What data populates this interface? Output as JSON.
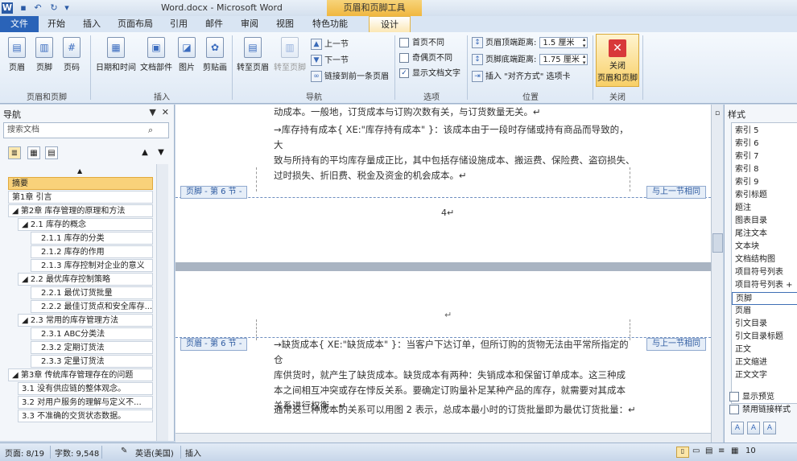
{
  "titlebar": {
    "title": "Word.docx - Microsoft Word",
    "context_group": "页眉和页脚工具"
  },
  "tabs": [
    "文件",
    "开始",
    "插入",
    "页面布局",
    "引用",
    "邮件",
    "审阅",
    "视图",
    "特色功能",
    "设计"
  ],
  "ribbon": {
    "groups": {
      "header_footer": "页眉和页脚",
      "insert": "插入",
      "navigation": "导航",
      "options": "选项",
      "position": "位置",
      "close": "关闭"
    },
    "header_btn": "页眉",
    "footer_btn": "页脚",
    "page_number_btn": "页码",
    "date_time_btn": "日期和时间",
    "doc_parts_btn": "文档部件",
    "picture_btn": "图片",
    "clipart_btn": "剪贴画",
    "goto_header_btn": "转至页眉",
    "goto_footer_btn": "转至页脚",
    "prev_section": "上一节",
    "next_section": "下一节",
    "link_previous": "链接到前一条页眉",
    "opt_diff_first": "首页不同",
    "opt_odd_even": "奇偶页不同",
    "opt_show_text": "显示文档文字",
    "header_top_label": "页眉顶端距离:",
    "header_top_value": "1.5 厘米",
    "footer_bottom_label": "页脚底端距离:",
    "footer_bottom_value": "1.75 厘米",
    "insert_align_tab": "插入 \"对齐方式\" 选项卡",
    "close_btn_line1": "关闭",
    "close_btn_line2": "页眉和页脚"
  },
  "nav": {
    "title": "导航",
    "search_placeholder": "搜索文档",
    "items": [
      {
        "label": "摘要",
        "level": 0,
        "selected": true
      },
      {
        "label": "第1章 引言",
        "level": 0
      },
      {
        "label": "◢ 第2章 库存管理的原理和方法",
        "level": 0
      },
      {
        "label": "◢ 2.1 库存的概念",
        "level": 1
      },
      {
        "label": "2.1.1 库存的分类",
        "level": 2
      },
      {
        "label": "2.1.2 库存的作用",
        "level": 2
      },
      {
        "label": "2.1.3 库存控制对企业的意义",
        "level": 2
      },
      {
        "label": "◢ 2.2 最优库存控制策略",
        "level": 1
      },
      {
        "label": "2.2.1 最优订货批量",
        "level": 2
      },
      {
        "label": "2.2.2 最佳订货点和安全库存...",
        "level": 2
      },
      {
        "label": "◢ 2.3 常用的库存管理方法",
        "level": 1
      },
      {
        "label": "2.3.1 ABC分类法",
        "level": 2
      },
      {
        "label": "2.3.2 定期订货法",
        "level": 2
      },
      {
        "label": "2.3.3 定量订货法",
        "level": 2
      },
      {
        "label": "◢ 第3章 传统库存管理存在的问题",
        "level": 0
      },
      {
        "label": "3.1 没有供应链的整体观念。",
        "level": 1
      },
      {
        "label": "3.2 对用户服务的理解与定义不...",
        "level": 1
      },
      {
        "label": "3.3 不准确的交货状态数据。",
        "level": 1
      }
    ]
  },
  "document": {
    "p0": "动成本。一般地，订货成本与订购次数有关，与订货数量无关。↵",
    "p1_line1": "→库存持有成本{ XE:\"库存持有成本\" }：该成本由于一段时存储或持有商品而导致的，大",
    "p1_line2": "致与所持有的平均库存量成正比，其中包括存储设施成本、搬运费、保险费、盗窃损失、",
    "p1_line3": "过时损失、折旧费、税金及资金的机会成本。↵",
    "footer_label_1": "页脚 - 第 6 节 -",
    "same_as_prev_1": "与上一节相同",
    "page_number_mark": "4↵",
    "para_mark_2": "↵",
    "footer_label_2": "页眉 - 第 6 节 -",
    "same_as_prev_2": "与上一节相同",
    "p2_line1": "→缺货成本{ XE:\"缺货成本\" }：当客户下达订单，但所订购的货物无法由平常所指定的仓",
    "p2_line2": "库供货时，就产生了缺货成本。缺货成本有两种：失销成本和保留订单成本。这三种成",
    "p2_line3": "本之间相互冲突或存在悖反关系。要确定订购量补足某种产品的库存，就需要对其成本",
    "p2_line4": "关系进行权衡。↵",
    "p3": "通常这三种成本的关系可以用图 2 表示，总成本最小时的订货批量即为最优订货批量：↵"
  },
  "styles_pane": {
    "title": "样式",
    "items": [
      "索引 5",
      "索引 6",
      "索引 7",
      "索引 8",
      "索引 9",
      "索引标题",
      "题注",
      "图表目录",
      "尾注文本",
      "文本块",
      "文档结构图",
      "项目符号列表",
      "项目符号列表 +",
      "页脚",
      "页眉",
      "引文目录",
      "引文目录标题",
      "正文",
      "正文缩进",
      "正文文字"
    ],
    "selected_index": 13,
    "show_preview": "显示预览",
    "disable_linked": "禁用链接样式"
  },
  "status": {
    "page": "页面: 8/19",
    "words": "字数: 9,548",
    "language": "英语(美国)",
    "mode": "插入",
    "zoom": "10"
  },
  "colors": {
    "file_tab": "#2a63b8",
    "context_accent": "#f0b73f",
    "nav_selected": "#f9d27a"
  }
}
